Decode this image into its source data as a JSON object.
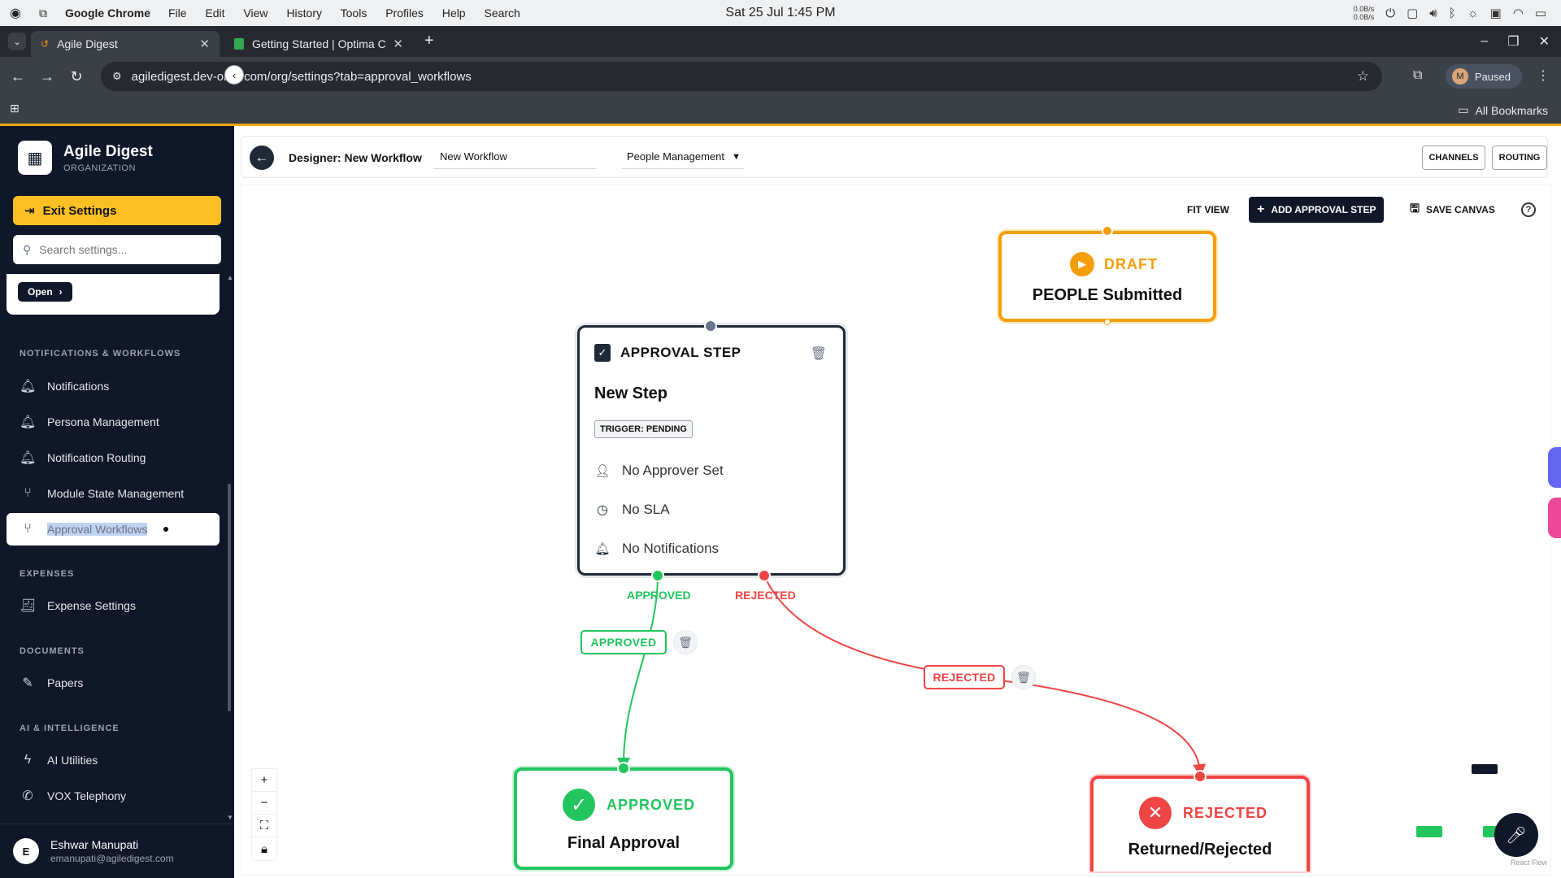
{
  "os": {
    "app": "Google Chrome",
    "menu": [
      "File",
      "Edit",
      "View",
      "History",
      "Tools",
      "Profiles",
      "Help",
      "Search"
    ],
    "clock": "Sat 25 Jul  1:45 PM",
    "net_up": "0.0B/s",
    "net_down": "0.0B/s"
  },
  "browser": {
    "tabs": [
      {
        "title": "Agile Digest"
      },
      {
        "title": "Getting Started | Optima C"
      }
    ],
    "url": "agiledigest.dev-orbit.com/org/settings?tab=approval_workflows",
    "profile_initial": "M",
    "profile_status": "Paused",
    "bookmarks_label": "All Bookmarks"
  },
  "sidebar": {
    "org_name": "Agile Digest",
    "org_type": "ORGANIZATION",
    "exit_label": "Exit Settings",
    "search_placeholder": "Search settings...",
    "open_label": "Open",
    "sections": [
      {
        "title": "NOTIFICATIONS & WORKFLOWS",
        "items": [
          {
            "label": "Notifications",
            "icon": "bell-icon"
          },
          {
            "label": "Persona Management",
            "icon": "bell-ring-icon"
          },
          {
            "label": "Notification Routing",
            "icon": "bell-ring-icon"
          },
          {
            "label": "Module State Management",
            "icon": "git-branch-icon"
          },
          {
            "label": "Approval Workflows",
            "icon": "git-pull-icon"
          }
        ]
      },
      {
        "title": "EXPENSES",
        "items": [
          {
            "label": "Expense Settings",
            "icon": "receipt-icon"
          }
        ]
      },
      {
        "title": "DOCUMENTS",
        "items": [
          {
            "label": "Papers",
            "icon": "edit-document-icon"
          }
        ]
      },
      {
        "title": "AI & INTELLIGENCE",
        "items": [
          {
            "label": "AI Utilities",
            "icon": "lightning-icon"
          },
          {
            "label": "VOX Telephony",
            "icon": "phone-icon"
          }
        ]
      }
    ],
    "user": {
      "initial": "E",
      "name": "Eshwar Manupati",
      "email": "emanupati@agiledigest.com"
    }
  },
  "designer": {
    "title": "Designer: New Workflow",
    "workflow_name": "New Workflow",
    "module": "People Management",
    "channels_label": "CHANNELS",
    "routing_label": "ROUTING"
  },
  "toolbar": {
    "fit_view": "FIT VIEW",
    "add_step": "ADD APPROVAL STEP",
    "save_canvas": "SAVE CANVAS"
  },
  "nodes": {
    "draft": {
      "status": "DRAFT",
      "title": "PEOPLE Submitted"
    },
    "approval": {
      "header": "APPROVAL STEP",
      "name": "New Step",
      "trigger": "TRIGGER: PENDING",
      "approver": "No Approver Set",
      "sla": "No SLA",
      "notifications": "No Notifications",
      "approved_handle": "APPROVED",
      "rejected_handle": "REJECTED"
    },
    "final": {
      "status": "APPROVED",
      "title": "Final Approval"
    },
    "rejected": {
      "status": "REJECTED",
      "title": "Returned/Rejected"
    }
  },
  "edges": {
    "approved_label": "APPROVED",
    "rejected_label": "REJECTED"
  },
  "attribution": "React Flow",
  "colors": {
    "accent": "#f3a712",
    "sidebar_bg": "#0f1729",
    "draft": "#f59e0b",
    "approved": "#22c55e",
    "rejected": "#ef4444"
  }
}
